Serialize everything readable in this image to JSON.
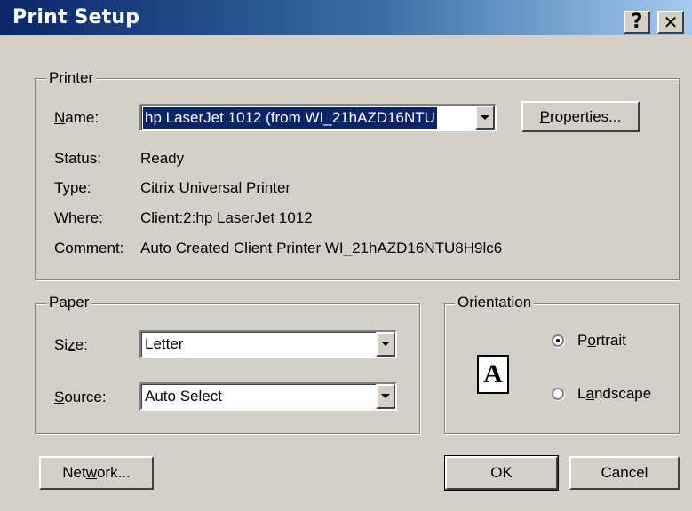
{
  "window": {
    "title": "Print Setup",
    "help_glyph": "?",
    "close_glyph": "✕"
  },
  "printer": {
    "legend": "Printer",
    "name_label": "Name:",
    "name_value": "hp LaserJet 1012 (from WI_21hAZD16NTU",
    "properties_label": "Properties...",
    "status_label": "Status:",
    "status_value": "Ready",
    "type_label": "Type:",
    "type_value": "Citrix Universal Printer",
    "where_label": "Where:",
    "where_value": "Client:2:hp LaserJet 1012",
    "comment_label": "Comment:",
    "comment_value": "Auto Created Client Printer WI_21hAZD16NTU8H9lc6"
  },
  "paper": {
    "legend": "Paper",
    "size_label": "Size:",
    "size_value": "Letter",
    "source_label": "Source:",
    "source_value": "Auto Select"
  },
  "orientation": {
    "legend": "Orientation",
    "page_letter": "A",
    "portrait_label": "Portrait",
    "landscape_label": "Landscape",
    "selected": "Portrait"
  },
  "buttons": {
    "network": "Network...",
    "ok": "OK",
    "cancel": "Cancel"
  }
}
